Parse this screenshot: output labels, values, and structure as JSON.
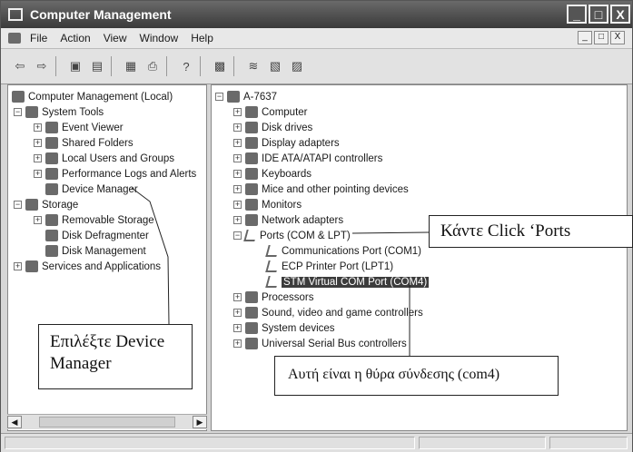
{
  "window": {
    "title": "Computer Management",
    "controls": {
      "minimize": "_",
      "maximize": "□",
      "close": "X"
    }
  },
  "menubar": {
    "items": [
      "File",
      "Action",
      "View",
      "Window",
      "Help"
    ],
    "mdi_controls": [
      "_",
      "□",
      "X"
    ]
  },
  "toolbar": {
    "icons": [
      "back-arrow-icon",
      "forward-arrow-icon",
      "up-folder-icon",
      "show-hide-tree-icon",
      "properties-icon",
      "print-icon",
      "help-icon",
      "scan-hardware-icon",
      "update-driver-icon",
      "uninstall-icon",
      "disable-icon"
    ]
  },
  "left_tree": {
    "root": "Computer Management (Local)",
    "system_tools": "System Tools",
    "event_viewer": "Event Viewer",
    "shared_folders": "Shared Folders",
    "local_users": "Local Users and Groups",
    "perf_logs": "Performance Logs and Alerts",
    "device_manager": "Device Manager",
    "storage": "Storage",
    "removable_storage": "Removable Storage",
    "disk_defrag": "Disk Defragmenter",
    "disk_mgmt": "Disk Management",
    "services_apps": "Services and Applications"
  },
  "device_tree": {
    "root": "A-7637",
    "computer": "Computer",
    "disk_drives": "Disk drives",
    "display_adapters": "Display adapters",
    "ide": "IDE ATA/ATAPI controllers",
    "keyboards": "Keyboards",
    "mice": "Mice and other pointing devices",
    "monitors": "Monitors",
    "network": "Network adapters",
    "ports": "Ports (COM & LPT)",
    "com1": "Communications Port (COM1)",
    "lpt1": "ECP Printer Port (LPT1)",
    "com4": "STM Virtual COM Port (COM4)",
    "processors": "Processors",
    "sound": "Sound, video and game controllers",
    "system_devices": "System devices",
    "usb": "Universal Serial Bus controllers"
  },
  "callouts": {
    "device_manager_line1": "Επιλέξτε Device",
    "device_manager_line2": "Manager",
    "ports": "Κάντε Click ‘Ports",
    "com4": "Αυτή είναι η θύρα σύνδεσης (com4)"
  },
  "colors": {
    "titlebar": "#4a4a4a",
    "window_bg": "#d6d6d6",
    "selection": "#3c3c3c"
  }
}
